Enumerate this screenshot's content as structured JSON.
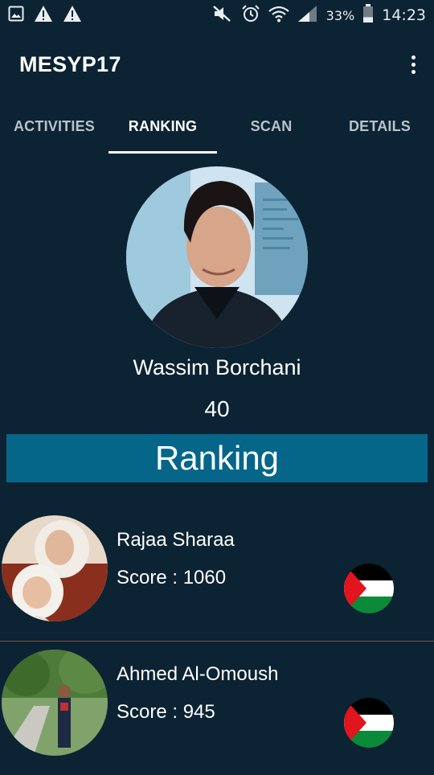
{
  "status_bar": {
    "time": "14:23",
    "battery_percent": "33%",
    "left_icons": [
      "image-icon",
      "warning-icon",
      "warning-icon"
    ],
    "right_icons": [
      "mute-icon",
      "alarm-icon",
      "wifi-icon",
      "signal-icon",
      "battery-icon"
    ],
    "battery_level": 0.33
  },
  "app_bar": {
    "title": "MESYP17",
    "menu_icon": "overflow-menu-icon"
  },
  "tabs": [
    {
      "label": "ACTIVITIES",
      "active": false
    },
    {
      "label": "RANKING",
      "active": true
    },
    {
      "label": "SCAN",
      "active": false
    },
    {
      "label": "DETAILS",
      "active": false
    }
  ],
  "profile": {
    "name": "Wassim Borchani",
    "score": "40"
  },
  "section_title": "Ranking",
  "ranking": [
    {
      "name": "Rajaa Sharaa",
      "score_text": "Score : 1060",
      "flag": "palestine-flag-icon"
    },
    {
      "name": "Ahmed Al-Omoush",
      "score_text": "Score : 945",
      "flag": "palestine-flag-icon"
    }
  ],
  "colors": {
    "background": "#0b2333",
    "ranking_bar": "#05668a",
    "divider": "#7a4b3b"
  }
}
